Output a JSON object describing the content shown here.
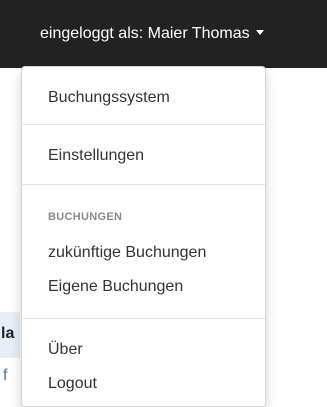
{
  "navbar": {
    "user_label": "eingeloggt als: Maier Thomas"
  },
  "background": {
    "bold_fragment": "la",
    "link_fragment": "f"
  },
  "menu": {
    "booking_system": "Buchungssystem",
    "settings": "Einstellungen",
    "bookings_header": "BUCHUNGEN",
    "future_bookings": "zukünftige Buchungen",
    "own_bookings": "Eigene Buchungen",
    "about": "Über",
    "logout": "Logout"
  },
  "colors": {
    "navbar_bg": "#222222",
    "text": "#333333",
    "header_text": "#8a8a8a",
    "link": "#337ab7"
  }
}
